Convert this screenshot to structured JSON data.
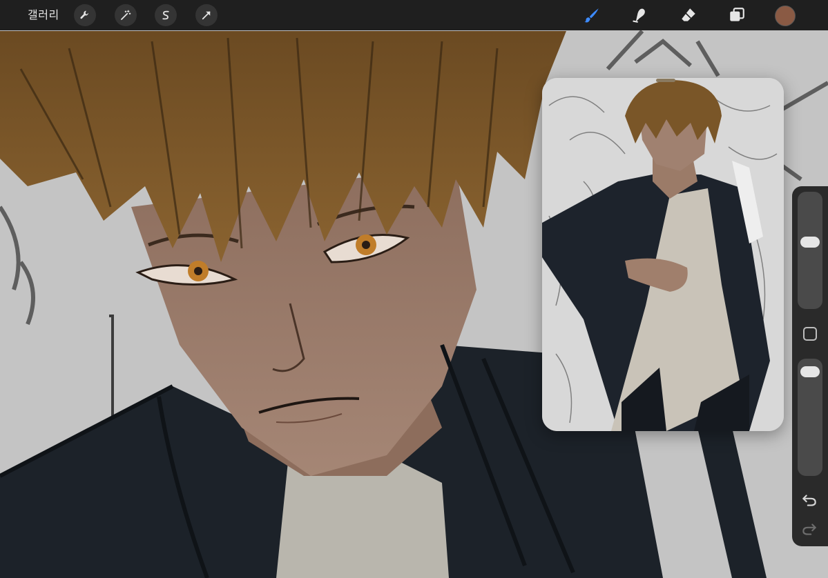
{
  "app": {
    "gallery_label": "갤러리",
    "accent_color": "#3d8bff",
    "toolbar_bg": "#1f1f1f"
  },
  "toolbar": {
    "left_icons": [
      "wrench-icon",
      "magic-wand-icon",
      "selection-s-icon",
      "transform-arrow-icon"
    ],
    "right_tools": [
      "brush-icon",
      "smudge-icon",
      "eraser-icon",
      "layers-icon"
    ],
    "active_tool": "brush",
    "current_color": "#8a5a44"
  },
  "sidebar": {
    "brush_size_level": 0.58,
    "brush_opacity_level": 0.95,
    "controls": [
      "brush-size-slider",
      "modifier-button",
      "opacity-slider",
      "undo-icon",
      "redo-icon"
    ]
  },
  "reference": {
    "visible": true
  }
}
